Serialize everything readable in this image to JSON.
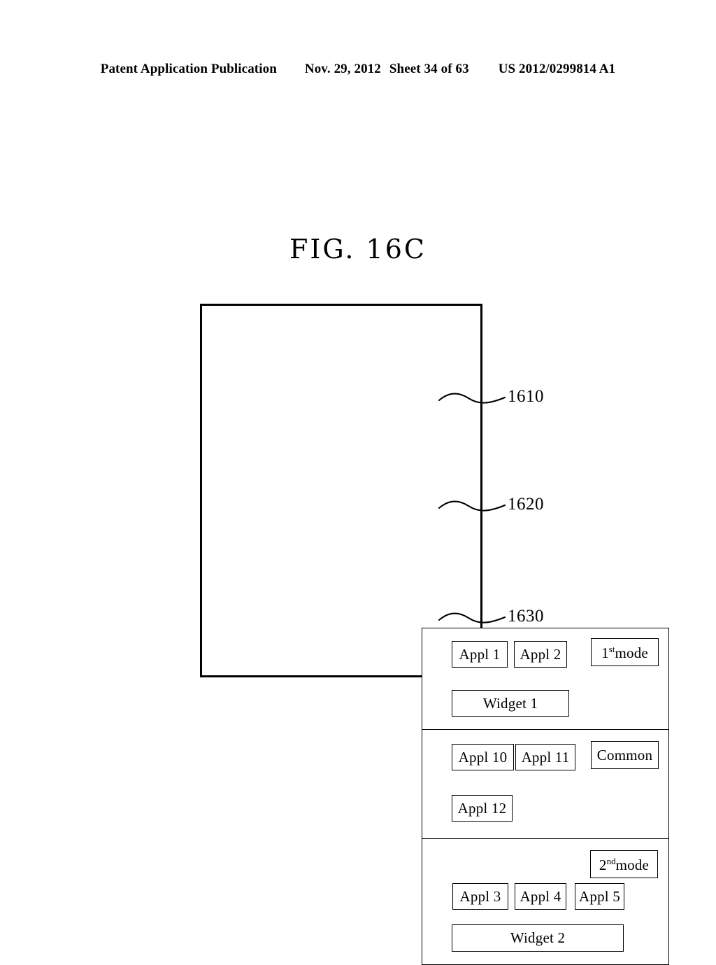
{
  "header": {
    "publication": "Patent Application Publication",
    "date": "Nov. 29, 2012",
    "sheet": "Sheet 34 of 63",
    "document_number": "US 2012/0299814 A1"
  },
  "figure": {
    "title": "FIG. 16C"
  },
  "diagram": {
    "sections": [
      {
        "reference_numeral": "1610",
        "mode_label_main": "mode",
        "mode_label_ordinal": "1",
        "mode_label_suffix": "st",
        "items": [
          "Appl 1",
          "Appl 2"
        ],
        "widget": "Widget 1"
      },
      {
        "reference_numeral": "1620",
        "mode_label_main": "Common",
        "items": [
          "Appl 10",
          "Appl 11",
          "Appl 12"
        ]
      },
      {
        "reference_numeral": "1630",
        "mode_label_main": "mode",
        "mode_label_ordinal": "2",
        "mode_label_suffix": "nd",
        "items": [
          "Appl 3",
          "Appl 4",
          "Appl 5"
        ],
        "widget": "Widget 2"
      }
    ]
  },
  "colors": {
    "ink": "#000000",
    "page": "#ffffff"
  }
}
